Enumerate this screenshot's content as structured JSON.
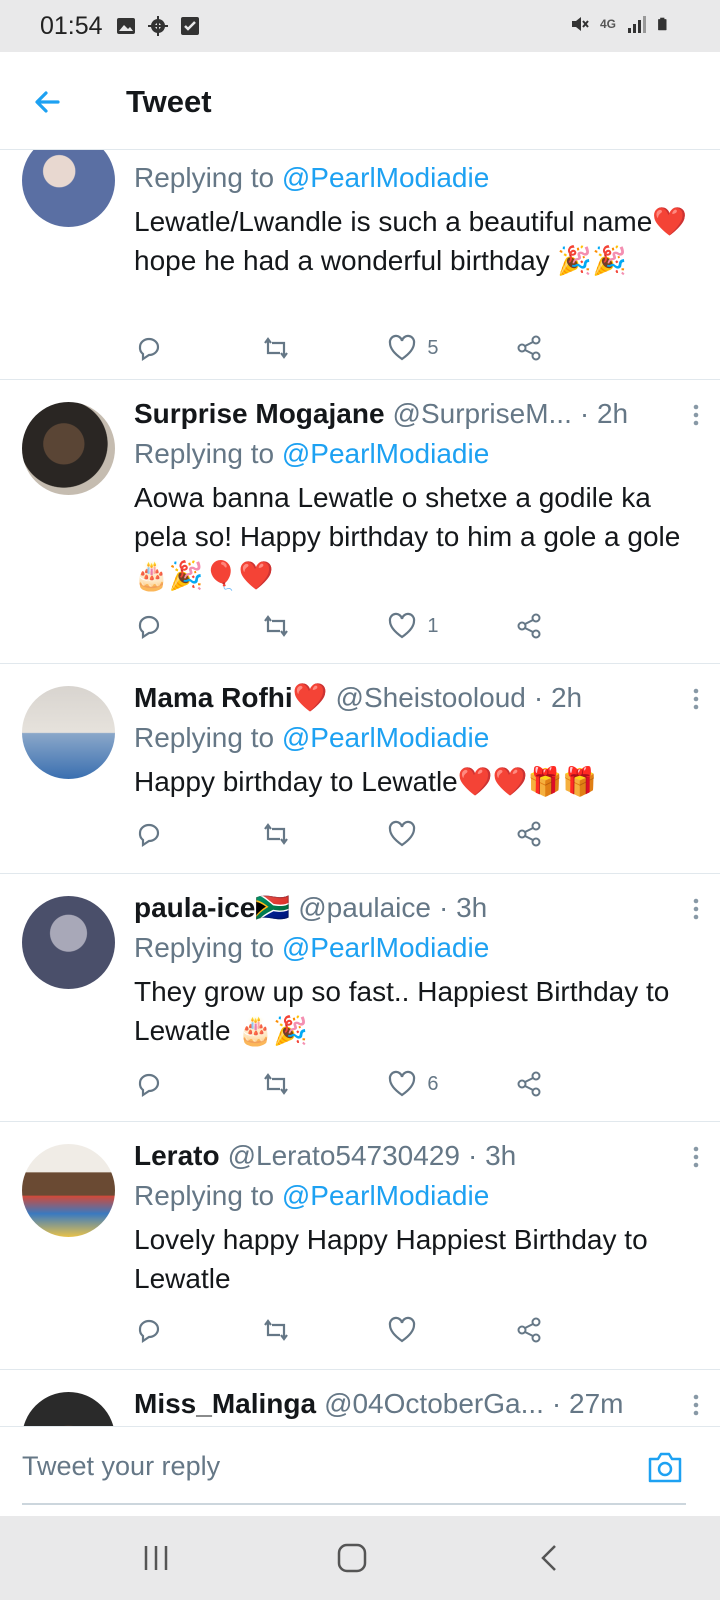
{
  "status_bar": {
    "time": "01:54",
    "network": "4G",
    "icons_left": [
      "image-icon",
      "gear-icon",
      "checkbox-icon"
    ],
    "icons_right": [
      "mute-icon",
      "network-4g-icon",
      "signal-icon",
      "battery-icon"
    ]
  },
  "header": {
    "title": "Tweet",
    "back_icon": "back-arrow-icon"
  },
  "colors": {
    "accent": "#1da1f2",
    "secondary_text": "#657786",
    "divider": "#e1e8ed",
    "system_bar": "#e9e9ea"
  },
  "tweets": [
    {
      "replying_prefix": "Replying to",
      "mention": "@PearlModiadie",
      "body": "Lewatle/Lwandle is such a beautiful name❤️hope he had a wonderful birthday 🎉🎉",
      "likes": "5"
    },
    {
      "name": "Surprise Mogajane",
      "handle": "@SurpriseM...",
      "time": "· 2h",
      "replying_prefix": "Replying to",
      "mention": "@PearlModiadie",
      "body": "Aowa banna Lewatle o shetxe a godile ka pela so! Happy birthday to him a gole a gole 🎂🎉🎈❤️",
      "likes": "1"
    },
    {
      "name": "Mama Rofhi❤️",
      "handle": "@Sheistooloud",
      "time": "· 2h",
      "replying_prefix": "Replying to",
      "mention": "@PearlModiadie",
      "body": "Happy birthday to Lewatle❤️❤️🎁🎁",
      "likes": ""
    },
    {
      "name": "paula-ice🇿🇦",
      "handle": "@paulaice",
      "time": "· 3h",
      "replying_prefix": "Replying to",
      "mention": "@PearlModiadie",
      "body": "They grow up so fast.. Happiest Birthday to Lewatle 🎂🎉",
      "likes": "6"
    },
    {
      "name": "Lerato",
      "handle": "@Lerato54730429",
      "time": "· 3h",
      "replying_prefix": "Replying to",
      "mention": "@PearlModiadie",
      "body": "Lovely happy Happy Happiest Birthday to Lewatle",
      "likes": ""
    },
    {
      "name": "Miss_Malinga",
      "handle": "@04OctoberGa...",
      "time": "· 27m"
    }
  ],
  "reply_bar": {
    "placeholder": "Tweet your reply",
    "camera_icon": "camera-icon"
  },
  "nav_bar": {
    "buttons": [
      "recents-icon",
      "home-icon",
      "back-icon"
    ]
  }
}
